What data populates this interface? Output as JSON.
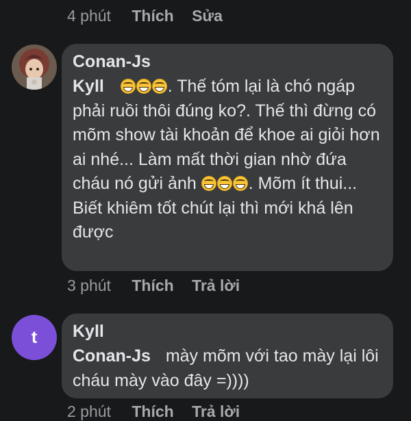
{
  "comment0_meta": {
    "time": "4 phút",
    "like": "Thích",
    "action": "Sửa"
  },
  "comments": [
    {
      "author": "Conan-Js",
      "mention": "Kyll",
      "text_part1": ". Thế tóm lại là chó ngáp phải ruồi thôi đúng ko?. Thế thì đừng có mõm show tài khoản để khoe ai giỏi hơn ai nhé... Làm mất thời gian nhờ đứa cháu nó gửi ảnh",
      "text_part2": ". Mõm ít thui... Biết khiêm tốt chút lại thì mới khá lên được",
      "meta": {
        "time": "3 phút",
        "like": "Thích",
        "reply": "Trả lời"
      },
      "emoji_name": "grinning-face-icon"
    },
    {
      "author": "Kyll",
      "avatar_letter": "t",
      "avatar_color": "#7b4fd8",
      "mention": "Conan-Js",
      "text": "mày mõm với tao mày lại lôi cháu mày vào đây =))))",
      "meta": {
        "time": "2 phút",
        "like": "Thích",
        "reply": "Trả lời"
      }
    }
  ],
  "colors": {
    "background": "#18191a",
    "bubble": "#3a3b3c",
    "text": "#e4e6eb",
    "meta": "#9a9ca1"
  }
}
